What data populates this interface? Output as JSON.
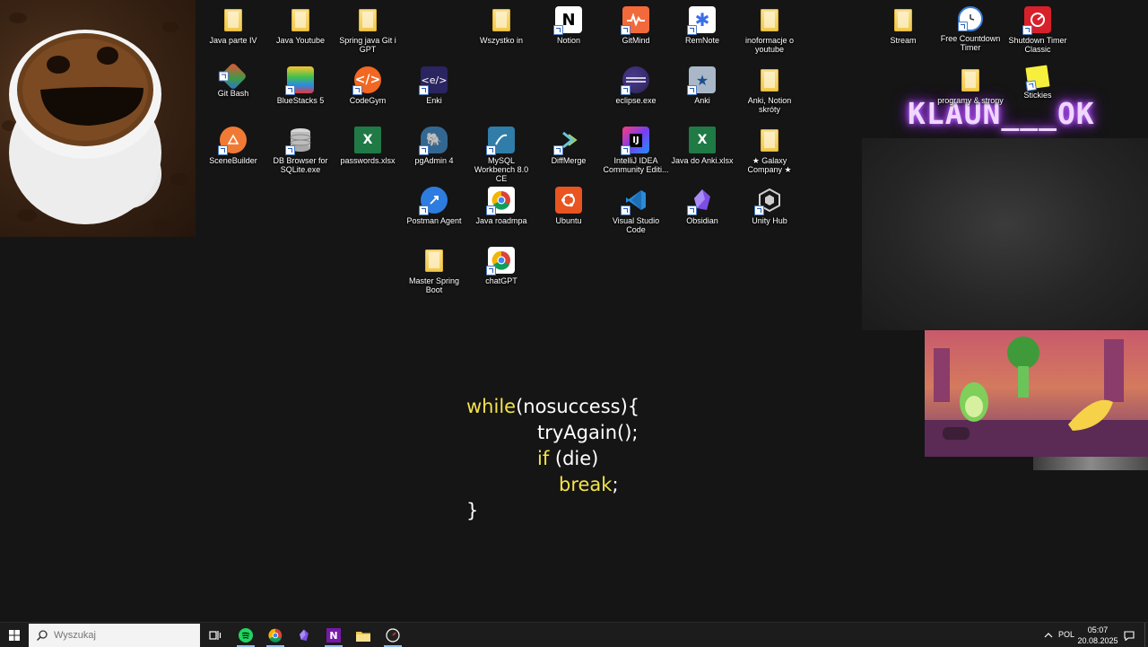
{
  "desktop": {
    "overlay_text": "KLAUN___OK",
    "icons": [
      {
        "label": "Java parte IV"
      },
      {
        "label": "Java Youtube"
      },
      {
        "label": "Spring java Git i GPT"
      },
      {
        "label": "Wszystko in"
      },
      {
        "label": "Notion"
      },
      {
        "label": "GitMind"
      },
      {
        "label": "RemNote"
      },
      {
        "label": "inoformacje o youtube"
      },
      {
        "label": "Stream"
      },
      {
        "label": "Free Countdown Timer"
      },
      {
        "label": "Shutdown Timer Classic"
      },
      {
        "label": "Git Bash"
      },
      {
        "label": "BlueStacks 5"
      },
      {
        "label": "CodeGym"
      },
      {
        "label": "Enki"
      },
      {
        "label": "eclipse.exe"
      },
      {
        "label": "Anki"
      },
      {
        "label": "Anki, Notion skróty"
      },
      {
        "label": "programy & strony"
      },
      {
        "label": "Stickies"
      },
      {
        "label": "SceneBuilder"
      },
      {
        "label": "DB Browser for SQLite.exe"
      },
      {
        "label": "passwords.xlsx"
      },
      {
        "label": "pgAdmin 4"
      },
      {
        "label": "MySQL Workbench 8.0 CE"
      },
      {
        "label": "DiffMerge"
      },
      {
        "label": "IntelliJ IDEA Community Editi..."
      },
      {
        "label": "Java do Anki.xlsx"
      },
      {
        "label": "★ Galaxy Company ★"
      },
      {
        "label": "Postman Agent"
      },
      {
        "label": "Java roadmpa"
      },
      {
        "label": "Ubuntu"
      },
      {
        "label": "Visual Studio Code"
      },
      {
        "label": "Obsidian"
      },
      {
        "label": "Unity Hub"
      },
      {
        "label": "Master Spring Boot"
      },
      {
        "label": "chatGPT"
      }
    ]
  },
  "wallpaper_code": {
    "line1_kw": "while",
    "line1_rest": "(nosuccess){",
    "line2": "tryAgain();",
    "line3_kw": "if",
    "line3_rest": " (die)",
    "line4_kw": "break",
    "line4_rest": ";",
    "line5": "}"
  },
  "taskbar": {
    "search_placeholder": "Wyszukaj",
    "apps": [
      "task-view",
      "spotify",
      "chrome",
      "obsidian",
      "onenote",
      "file-explorer",
      "clock-app"
    ],
    "language": "POL",
    "time": "05:07",
    "date": "20.08.2025"
  },
  "colors": {
    "keyword": "#f2e34b",
    "code_text": "#ffffff",
    "desktop_bg": "#151515",
    "taskbar_bg": "#1c1c1c"
  }
}
